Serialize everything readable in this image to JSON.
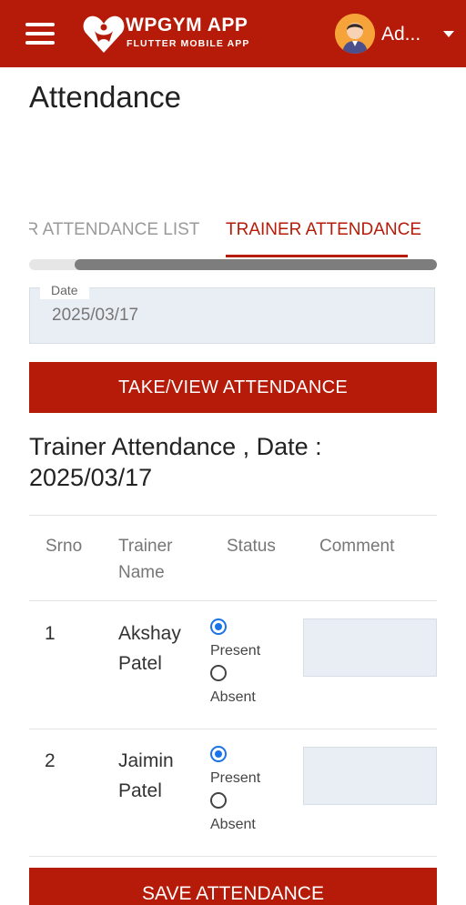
{
  "header": {
    "brand_title": "WPGYM APP",
    "brand_subtitle": "FLUTTER MOBILE APP",
    "user_name": "Ad...",
    "accent_color": "#B51B08"
  },
  "page": {
    "title": "Attendance"
  },
  "tabs": [
    {
      "label": "ER ATTENDANCE LIST",
      "active": false
    },
    {
      "label": "TRAINER ATTENDANCE",
      "active": true
    }
  ],
  "date_field": {
    "label": "Date",
    "value": "2025/03/17"
  },
  "buttons": {
    "take_view": "TAKE/VIEW  ATTENDANCE",
    "save": "SAVE ATTENDANCE"
  },
  "section_title": "Trainer Attendance , Date : 2025/03/17",
  "table": {
    "headers": {
      "srno": "Srno",
      "trainer_name": "Trainer Name",
      "status": "Status",
      "comment": "Comment"
    },
    "options": {
      "present": "Present",
      "absent": "Absent"
    },
    "rows": [
      {
        "srno": "1",
        "first": "Akshay",
        "last": "Patel",
        "status": "Present",
        "comment": ""
      },
      {
        "srno": "2",
        "first": "Jaimin",
        "last": "Patel",
        "status": "Present",
        "comment": ""
      }
    ]
  }
}
